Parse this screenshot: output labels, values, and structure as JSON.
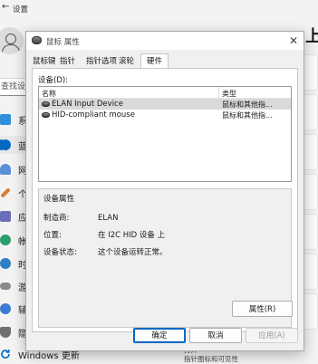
{
  "settings": {
    "title": "设置",
    "search_placeholder": "查找设置",
    "nav": [
      {
        "label": "系",
        "icon": "system-icon",
        "color": "#2f8fdb"
      },
      {
        "label": "蓝",
        "icon": "bluetooth-icon",
        "color": "#0067c0"
      },
      {
        "label": "网",
        "icon": "network-icon",
        "color": "#5b8fd6"
      },
      {
        "label": "个",
        "icon": "personalization-icon",
        "color": "#d87b31"
      },
      {
        "label": "应",
        "icon": "apps-icon",
        "color": "#6b6fb5"
      },
      {
        "label": "帐",
        "icon": "accounts-icon",
        "color": "#2a9d6b"
      },
      {
        "label": "时",
        "icon": "time-language-icon",
        "color": "#2e7fc2"
      },
      {
        "label": "游",
        "icon": "gaming-icon",
        "color": "#8a8a8a"
      },
      {
        "label": "辅",
        "icon": "accessibility-icon",
        "color": "#3a7bd5"
      },
      {
        "label": "隐",
        "icon": "privacy-icon",
        "color": "#6f6f6f"
      }
    ],
    "windows_update": "Windows 更新",
    "right_heading": "上",
    "bottom_fragments": [
      "打开",
      "指针图标和可见性"
    ]
  },
  "dialog": {
    "title": "鼠标 属性",
    "tabs": [
      "鼠标键",
      "指针",
      "指针选项",
      "滚轮",
      "硬件"
    ],
    "active_tab": "硬件",
    "devices_label": "设备(D):",
    "columns": {
      "name": "名称",
      "type": "类型"
    },
    "devices": [
      {
        "name": "ELAN Input Device",
        "type": "鼠标和其他指..."
      },
      {
        "name": "HID-compliant mouse",
        "type": "鼠标和其他指..."
      }
    ],
    "properties": {
      "group_title": "设备属性",
      "manufacturer_label": "制造商:",
      "manufacturer_value": "ELAN",
      "location_label": "位置:",
      "location_value": "在 I2C HID 设备 上",
      "status_label": "设备状态:",
      "status_value": "这个设备运转正常。",
      "properties_button": "属性(R)"
    },
    "buttons": {
      "ok": "确定",
      "cancel": "取消",
      "apply": "应用(A)"
    }
  }
}
